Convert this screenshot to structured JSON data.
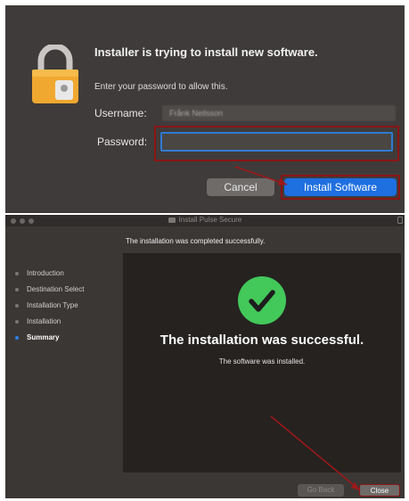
{
  "auth_dialog": {
    "title": "Installer is trying to install new software.",
    "message": "Enter your password to allow this.",
    "username_label": "Username:",
    "username_value": "Frånk Neilsson",
    "password_label": "Password:",
    "password_value": "",
    "cancel_label": "Cancel",
    "install_label": "Install Software",
    "icon": "lock-icon",
    "highlight_color": "#8b1414",
    "accent_color": "#1e6fe0"
  },
  "installer": {
    "window_title": "Install Pulse Secure",
    "completed_message": "The installation was completed successfully.",
    "steps": [
      {
        "label": "Introduction",
        "active": false
      },
      {
        "label": "Destination Select",
        "active": false
      },
      {
        "label": "Installation Type",
        "active": false
      },
      {
        "label": "Installation",
        "active": false
      },
      {
        "label": "Summary",
        "active": true
      }
    ],
    "success_title": "The installation was successful.",
    "success_subtitle": "The software was installed.",
    "go_back_label": "Go Back",
    "close_label": "Close",
    "success_color": "#43c85a"
  }
}
